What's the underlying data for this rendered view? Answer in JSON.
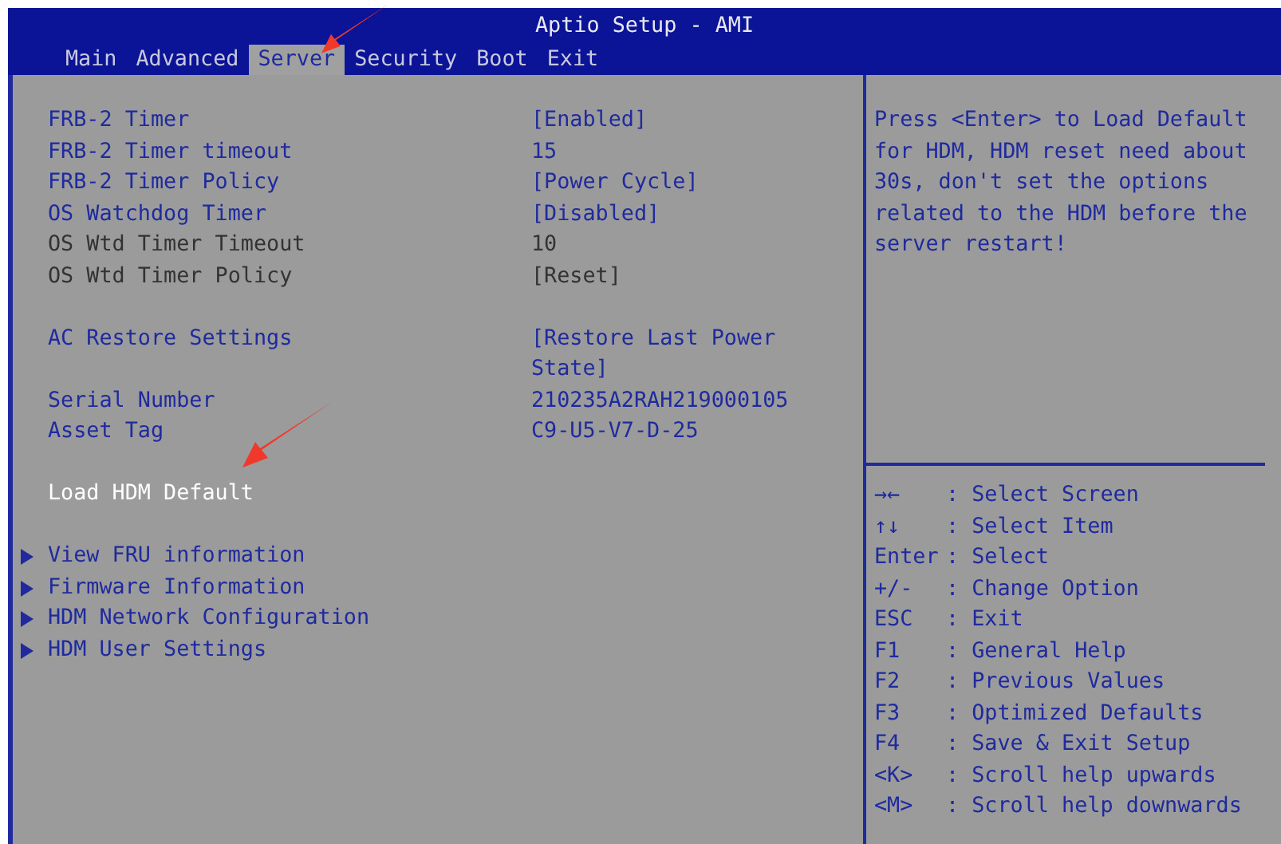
{
  "window": {
    "title": "Aptio Setup - AMI"
  },
  "tabs": [
    {
      "label": "Main",
      "selected": false
    },
    {
      "label": "Advanced",
      "selected": false
    },
    {
      "label": "Server",
      "selected": true
    },
    {
      "label": "Security",
      "selected": false
    },
    {
      "label": "Boot",
      "selected": false
    },
    {
      "label": "Exit",
      "selected": false
    }
  ],
  "groups": [
    [
      {
        "kind": "setting",
        "label": "FRB-2 Timer",
        "value": "[Enabled]",
        "disabled": false,
        "selected": false
      },
      {
        "kind": "setting",
        "label": "FRB-2 Timer timeout",
        "value": "15",
        "disabled": false,
        "selected": false
      },
      {
        "kind": "setting",
        "label": "FRB-2 Timer Policy",
        "value": "[Power Cycle]",
        "disabled": false,
        "selected": false
      },
      {
        "kind": "setting",
        "label": "OS Watchdog Timer",
        "value": "[Disabled]",
        "disabled": false,
        "selected": false
      },
      {
        "kind": "setting",
        "label": "OS Wtd Timer Timeout",
        "value": "10",
        "disabled": true,
        "selected": false
      },
      {
        "kind": "setting",
        "label": "OS Wtd Timer Policy",
        "value": "[Reset]",
        "disabled": true,
        "selected": false
      }
    ],
    [
      {
        "kind": "setting",
        "label": "AC Restore Settings",
        "value": "[Restore Last Power State]",
        "disabled": false,
        "selected": false
      },
      {
        "kind": "setting",
        "label": "Serial Number",
        "value": "210235A2RAH219000105",
        "disabled": false,
        "selected": false
      },
      {
        "kind": "setting",
        "label": "Asset Tag",
        "value": "C9-U5-V7-D-25",
        "disabled": false,
        "selected": false
      }
    ],
    [
      {
        "kind": "action",
        "label": "Load HDM Default",
        "disabled": false,
        "selected": true
      }
    ],
    [
      {
        "kind": "submenu",
        "label": "View FRU information",
        "disabled": false,
        "selected": false
      },
      {
        "kind": "submenu",
        "label": "Firmware Information",
        "disabled": false,
        "selected": false
      },
      {
        "kind": "submenu",
        "label": "HDM Network Configuration",
        "disabled": false,
        "selected": false
      },
      {
        "kind": "submenu",
        "label": "HDM User Settings",
        "disabled": false,
        "selected": false
      }
    ]
  ],
  "help_text": "Press <Enter> to Load Default for HDM, HDM reset need about 30s, don't set the options related to the HDM before the server restart!",
  "keys": [
    {
      "key": "→←",
      "action": ": Select Screen"
    },
    {
      "key": "↑↓",
      "action": ": Select Item"
    },
    {
      "key": "Enter",
      "action": ": Select"
    },
    {
      "key": "+/-",
      "action": ": Change Option"
    },
    {
      "key": "ESC",
      "action": ": Exit"
    },
    {
      "key": "F1",
      "action": ": General Help"
    },
    {
      "key": "F2",
      "action": ": Previous Values"
    },
    {
      "key": "F3",
      "action": ": Optimized Defaults"
    },
    {
      "key": "F4",
      "action": ": Save & Exit Setup"
    },
    {
      "key": "<K>",
      "action": ": Scroll help upwards"
    },
    {
      "key": "<M>",
      "action": ": Scroll help downwards"
    }
  ]
}
